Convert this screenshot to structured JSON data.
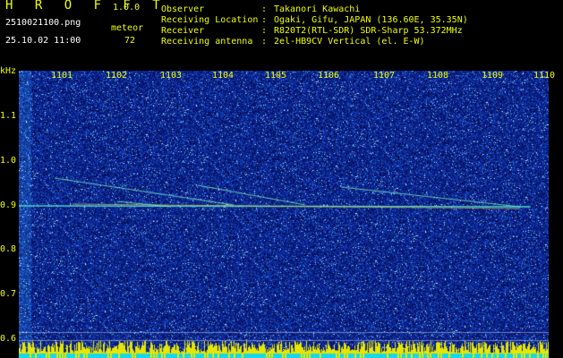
{
  "app": {
    "title": "H R O F F T",
    "version": "1.0.0"
  },
  "file": {
    "name": "2510021100.png",
    "datetime": "25.10.02 11:00"
  },
  "meteor": {
    "label": "meteor",
    "count": "72"
  },
  "info": [
    {
      "label": "Observer",
      "value": "Takanori Kawachi"
    },
    {
      "label": "Receiving Location",
      "value": "Ogaki, Gifu, JAPAN (136.60E, 35.35N)"
    },
    {
      "label": "Receiver",
      "value": "R820T2(RTL-SDR) SDR-Sharp 53.372MHz"
    },
    {
      "label": "Receiving antenna",
      "value": "2el-HB9CV Vertical (el. E-W)"
    }
  ],
  "axis": {
    "unit": "kHz",
    "time_ticks": [
      "1101",
      "1102",
      "1103",
      "1104",
      "1105",
      "1106",
      "1107",
      "1108",
      "1109",
      "1110"
    ],
    "freq_ticks": [
      "1.1",
      "1.0",
      "0.9",
      "0.8",
      "0.7",
      "0.6"
    ]
  },
  "colors": {
    "label": "#f0ff00",
    "text": "#ffffff",
    "background_noise": "#0a1f8c",
    "carrier": "#40e0d0"
  }
}
